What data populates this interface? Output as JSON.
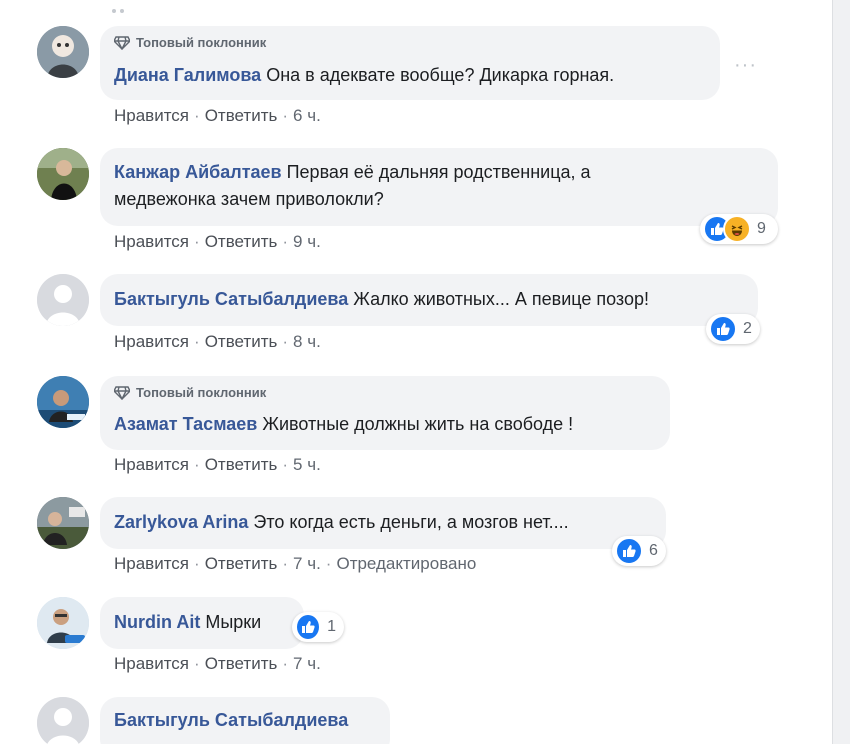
{
  "actions": {
    "like": "Нравится",
    "reply": "Ответить",
    "separator": "·"
  },
  "comments": [
    {
      "badge": "Топовый поклонник",
      "author": "Диана Галимова",
      "text": "Она в адеквате вообще? Дикарка горная.",
      "time": "6 ч."
    },
    {
      "author": "Канжар Айбалтаев",
      "text_line1": "Первая её дальняя родственница, а",
      "text_line2": "медвежонка зачем приволокли?",
      "time": "9 ч.",
      "reactions": {
        "types": [
          "like-icon",
          "haha-icon"
        ],
        "count": "9"
      }
    },
    {
      "author": "Бактыгуль Сатыбалдиева",
      "text": "Жалко животных... А певице позор!",
      "time": "8 ч.",
      "reactions": {
        "types": [
          "like-icon"
        ],
        "count": "2"
      }
    },
    {
      "badge": "Топовый поклонник",
      "author": "Азамат Тасмаев",
      "text": "Животные должны жить на свободе !",
      "time": "5 ч."
    },
    {
      "author": "Zarlykova Arina",
      "text": "Это когда есть деньги, а мозгов нет....",
      "time": "7 ч.",
      "edited": "Отредактировано",
      "reactions": {
        "types": [
          "like-icon"
        ],
        "count": "6"
      }
    },
    {
      "author": "Nurdin Ait",
      "text": "Мырки",
      "time": "7 ч.",
      "reactions": {
        "types": [
          "like-icon"
        ],
        "count": "1"
      }
    },
    {
      "author": "Бактыгуль Сатыбалдиева"
    }
  ],
  "colors": {
    "author": "#385898",
    "bubble": "#f2f3f5",
    "like": "#1877f2",
    "haha": "#f7b125"
  }
}
